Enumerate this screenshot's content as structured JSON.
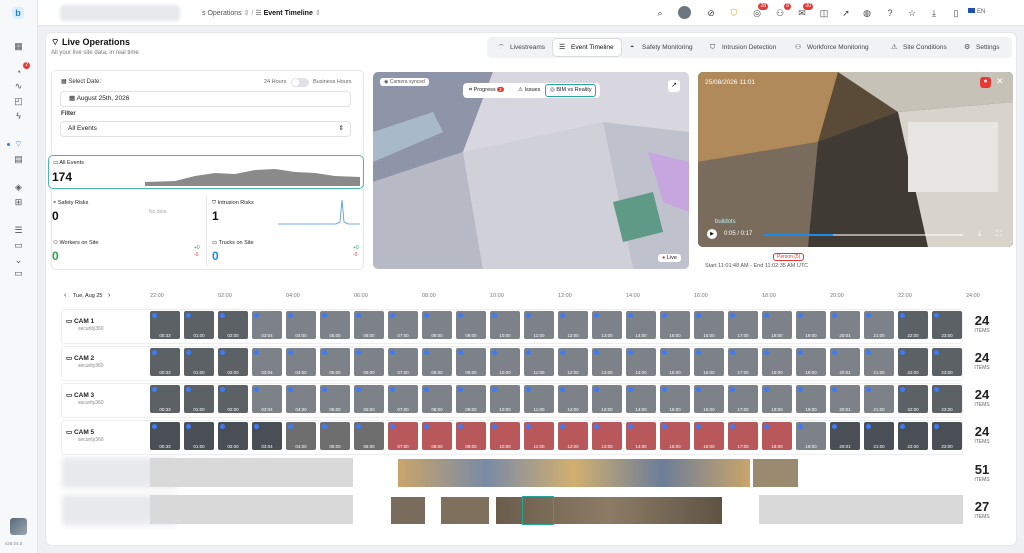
{
  "breadcrumb": {
    "parent": "s Operations",
    "current": "Event Timeline"
  },
  "header": {
    "title": "Live Operations",
    "subtitle": "All your live site data, in real time"
  },
  "tabs": [
    {
      "label": "Livestreams",
      "icon": "broadcast-icon"
    },
    {
      "label": "Event Timeline",
      "icon": "timeline-icon"
    },
    {
      "label": "Safety Monitoring",
      "icon": "hardhat-icon"
    },
    {
      "label": "Intrusion Detection",
      "icon": "shield-icon"
    },
    {
      "label": "Workforce Monitoring",
      "icon": "people-icon"
    },
    {
      "label": "Site Conditions",
      "icon": "warning-icon"
    },
    {
      "label": "Settings",
      "icon": "gear-icon"
    }
  ],
  "topbar": {
    "badges": {
      "a": "28",
      "b": "8",
      "c": "20"
    },
    "lang": "EN"
  },
  "sidebar": {
    "badge": "2",
    "version": "v26.04.0"
  },
  "filters": {
    "select_date_label": "Select Date:",
    "toggle_24": "24 Hours",
    "toggle_business": "Business Hours",
    "date_value": "August 25th, 2026",
    "filter_label": "Filter",
    "filter_value": "All Events"
  },
  "stats": {
    "all_events_label": "All Events",
    "all_events": "174",
    "safety_label": "Safety Risks",
    "safety": "0",
    "safety_nodata": "No data",
    "intrusion_label": "Intrusion Risks",
    "intrusion": "1",
    "workers_label": "Workers on Site",
    "workers": "0",
    "workers_delta_up": "+0",
    "workers_delta_down": "-0",
    "trucks_label": "Trucks on Site",
    "trucks": "0",
    "trucks_delta_up": "+0",
    "trucks_delta_down": "-0"
  },
  "bim": {
    "camera_synced": "Camera synced",
    "progress": "Progress",
    "progress_badge": "2",
    "issues": "Issues",
    "bim_vs_reality": "BIM vs Reality",
    "live": "Live"
  },
  "video": {
    "timestamp": "25/08/2026 11:01",
    "time": "0:05 / 0:17",
    "watermark": "buildots",
    "person_tag": "Person (5)",
    "range": "Start 11:01:48 AM - End 11:02:35 AM UTC"
  },
  "timeline": {
    "day": "Tue, Aug 25",
    "hours": [
      "22:00",
      "02:00",
      "04:00",
      "06:00",
      "08:00",
      "10:00",
      "12:00",
      "14:00",
      "16:00",
      "18:00",
      "20:00",
      "22:00",
      "24:00"
    ],
    "rows": [
      {
        "name": "CAM 1",
        "sub": "security360",
        "count": "24",
        "items": "ITEMS"
      },
      {
        "name": "CAM 2",
        "sub": "security360",
        "count": "24",
        "items": "ITEMS"
      },
      {
        "name": "CAM 3",
        "sub": "security360",
        "count": "24",
        "items": "ITEMS"
      },
      {
        "name": "CAM 5",
        "sub": "security360",
        "count": "24",
        "items": "ITEMS"
      }
    ],
    "extra": [
      {
        "count": "51",
        "items": "ITEMS"
      },
      {
        "count": "27",
        "items": "ITEMS"
      }
    ],
    "thumb_times": [
      "00:33",
      "01:00",
      "02:00",
      "03:04",
      "04:00",
      "05:00",
      "06:00",
      "07:00",
      "08:00",
      "09:00",
      "10:00",
      "11:00",
      "12:00",
      "13:00",
      "14:00",
      "15:00",
      "16:00",
      "17:00",
      "18:00",
      "19:00",
      "20:01",
      "21:00",
      "22:00",
      "23:00"
    ]
  }
}
